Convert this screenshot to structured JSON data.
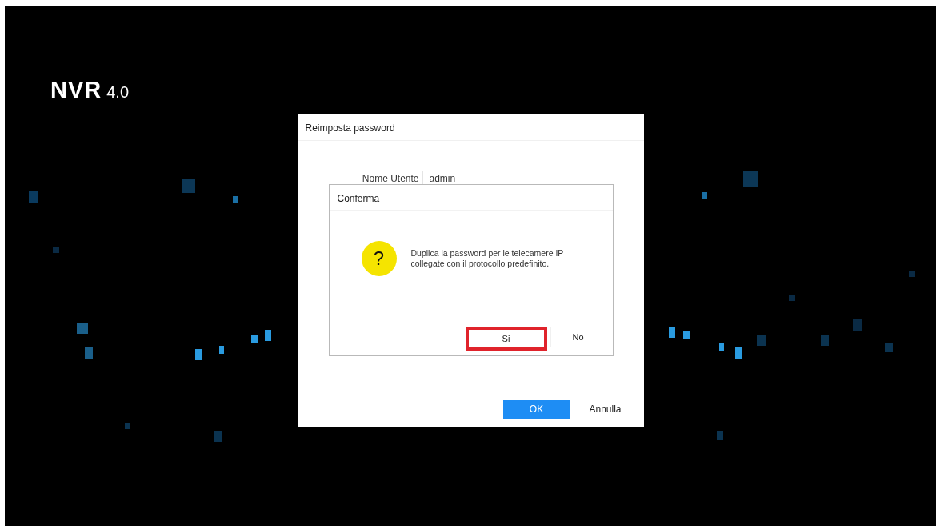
{
  "logo": {
    "name": "NVR",
    "version": "4.0"
  },
  "dialog": {
    "title": "Reimposta password",
    "fields": [
      {
        "label": "Nome Utente",
        "value": "admin"
      }
    ],
    "buttons": [
      {
        "label": "OK",
        "kind": "primary"
      },
      {
        "label": "Annulla",
        "kind": "plain"
      }
    ]
  },
  "confirm": {
    "title": "Conferma",
    "message": "Duplica la password per le telecamere IP collegate con il protocollo predefinito.",
    "icon": "?",
    "buttons": [
      {
        "label": "Si",
        "highlighted": true
      },
      {
        "label": "No",
        "highlighted": false
      }
    ]
  }
}
